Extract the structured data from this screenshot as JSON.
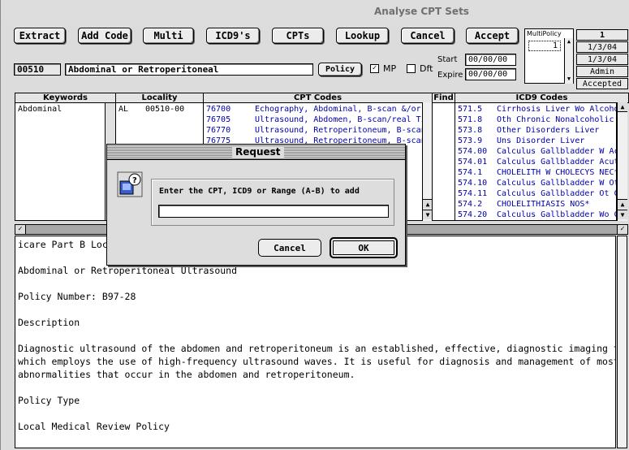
{
  "window": {
    "title": "Analyse CPT Sets"
  },
  "toolbar": {
    "extract": "Extract",
    "add_code": "Add Code",
    "multi": "Multi",
    "icd9s": "ICD9's",
    "cpts": "CPTs",
    "lookup": "Lookup",
    "cancel": "Cancel",
    "accept": "Accept"
  },
  "policy": {
    "number": "00510",
    "name": "Abdominal or Retroperitoneal",
    "policy_button": "Policy",
    "mp_label": "MP",
    "mp_checked": "✓",
    "dft_label": "Dft",
    "start_label": "Start",
    "start_value": "00/00/00",
    "expire_label": "Expire",
    "expire_value": "00/00/00"
  },
  "multipolicy": {
    "header": "MultiPolicy",
    "selected": "1"
  },
  "right_info": {
    "count": "1",
    "date1": "1/3/04",
    "date2": "1/3/04",
    "user": "Admin",
    "status": "Accepted"
  },
  "headers": {
    "keywords": "Keywords",
    "locality": "Locality",
    "cpt": "CPT Codes",
    "find": "Find",
    "icd9": "ICD9 Codes"
  },
  "keywords": [
    "Abdominal"
  ],
  "locality": [
    {
      "state": "AL",
      "code": "00510-00"
    }
  ],
  "cpt_rows": [
    {
      "code": "76700",
      "desc": "Echography, Abdominal, B-scan &/or Real"
    },
    {
      "code": "76705",
      "desc": "Ultrasound, Abdomen, B-scan/real Time; L"
    },
    {
      "code": "76770",
      "desc": "Ultrasound, Retroperitoneum, B-scan/rea"
    },
    {
      "code": "76775",
      "desc": "Ultrasound, Retroperitoneum, B-scan/rea"
    }
  ],
  "icd9_rows": [
    {
      "code": "571.5",
      "desc": "Cirrhosis Liver Wo Alcohol"
    },
    {
      "code": "571.8",
      "desc": "Oth Chronic Nonalcoholic Live"
    },
    {
      "code": "573.8",
      "desc": "Other Disorders Liver"
    },
    {
      "code": "573.9",
      "desc": "Uns Disorder Liver"
    },
    {
      "code": "574.00",
      "desc": "Calculus Gallbladder W Acute"
    },
    {
      "code": "574.01",
      "desc": "Calculus Gallbladder Acutecys"
    },
    {
      "code": "574.1",
      "desc": "CHOLELITH W CHOLECYS NEC*"
    },
    {
      "code": "574.10",
      "desc": "Calculus Gallbladder W Otcyst"
    },
    {
      "code": "574.11",
      "desc": "Calculus Gallbladder Ot Cyst O"
    },
    {
      "code": "574.2",
      "desc": "CHOLELITHIASIS NOS*"
    },
    {
      "code": "574.20",
      "desc": "Calculus Gallbladder Wo Cysti"
    }
  ],
  "policy_text": {
    "line1": "icare Part B Local",
    "line2": "Abdominal or Retroperitoneal Ultrasound",
    "line3": "Policy Number: B97-28",
    "line4": "Description",
    "line5": "Diagnostic ultrasound of the abdomen and retroperitoneum is an established, effective, diagnostic imaging technique",
    "line6": "which employs the use of high-frequency ultrasound waves. It is useful for diagnosis and management of most of the",
    "line7": "abnormalities that occur in the abdomen and retroperitoneum.",
    "line8": "Policy Type",
    "line9": "Local Medical Review Policy"
  },
  "split_check": "✓",
  "dialog": {
    "title": "Request",
    "prompt": "Enter the CPT, ICD9 or Range (A-B) to add",
    "input_value": "",
    "cancel": "Cancel",
    "ok": "OK"
  }
}
